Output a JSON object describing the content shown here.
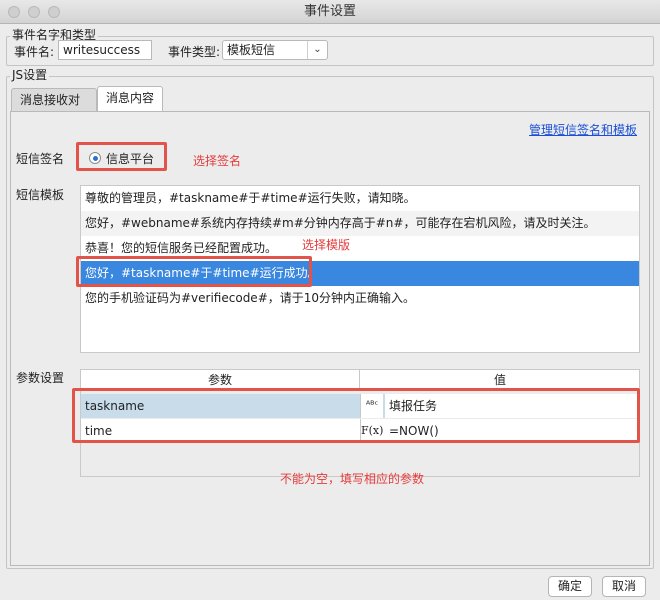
{
  "window": {
    "title": "事件设置"
  },
  "event_group": {
    "title": "事件名字和类型",
    "name_label": "事件名:",
    "name_value": "writesuccess",
    "type_label": "事件类型:",
    "type_value": "模板短信"
  },
  "js_group": {
    "title": "JS设置"
  },
  "tabs": [
    {
      "label": "消息接收对象",
      "active": false
    },
    {
      "label": "消息内容",
      "active": true
    }
  ],
  "manage_link": "管理短信签名和模板",
  "signature": {
    "label": "短信签名",
    "option": "信息平台",
    "selected": true,
    "annotation": "选择签名"
  },
  "template": {
    "label": "短信模板",
    "annotation": "选择模版",
    "items": [
      "尊敬的管理员，#taskname#于#time#运行失败，请知晓。",
      "您好，#webname#系统内存持续#m#分钟内存高于#n#，可能存在宕机风险，请及时关注。",
      "恭喜！您的短信服务已经配置成功。",
      "您好，#taskname#于#time#运行成功。",
      "您的手机验证码为#verifiecode#，请于10分钟内正确输入。"
    ],
    "selected_index": 3
  },
  "params": {
    "label": "参数设置",
    "col_name": "参数",
    "col_value": "值",
    "rows": [
      {
        "name": "taskname",
        "icon": "abc-text-icon",
        "value": "填报任务"
      },
      {
        "name": "time",
        "icon": "formula-icon",
        "value": "=NOW()"
      }
    ],
    "annotation": "不能为空，填写相应的参数"
  },
  "footer": {
    "ok_label": "确定",
    "cancel_label": "取消"
  },
  "colors": {
    "accent": "#3a87e0",
    "annotation": "#e2544a",
    "link": "#1a4fd6"
  }
}
